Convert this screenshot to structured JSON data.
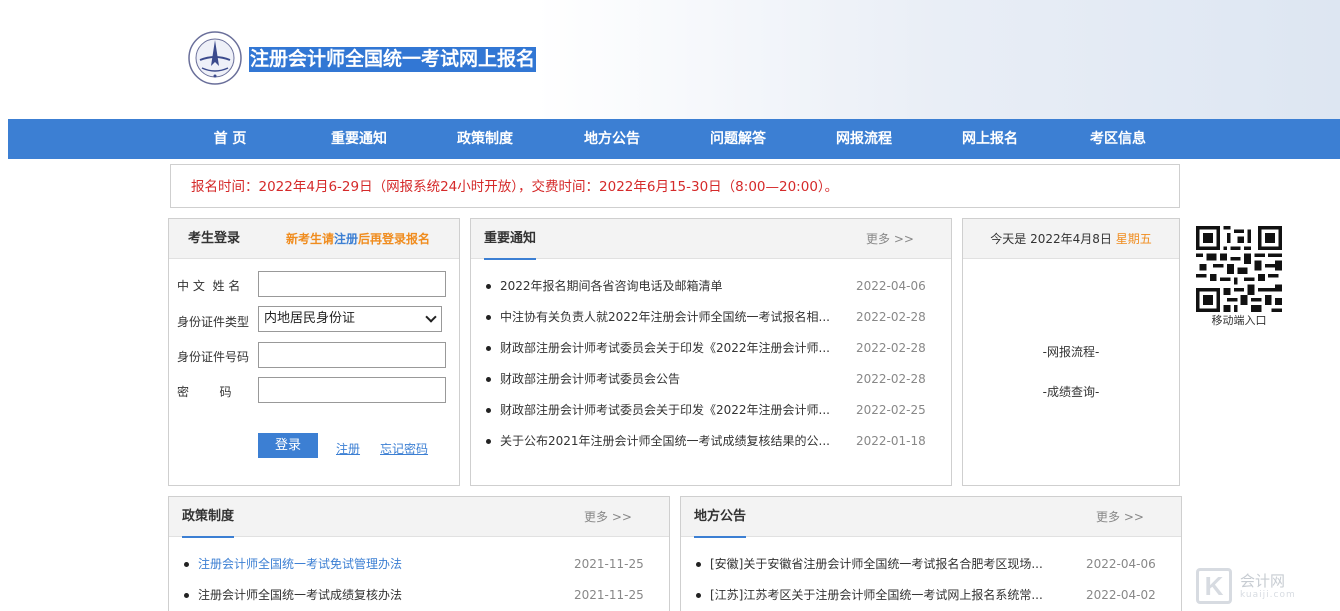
{
  "header": {
    "title": "注册会计师全国统一考试网上报名"
  },
  "nav": [
    "首 页",
    "重要通知",
    "政策制度",
    "地方公告",
    "问题解答",
    "网报流程",
    "网上报名",
    "考区信息"
  ],
  "notice": "报名时间：2022年4月6-29日（网报系统24小时开放），交费时间：2022年6月15-30日（8:00—20:00）。",
  "login": {
    "title": "考生登录",
    "new_prefix": "新考生请",
    "new_register": "注册",
    "new_suffix": "后再登录报名",
    "name_label": "中 文  姓 名",
    "idtype_label": "身份证件类型",
    "idtype_value": "内地居民身份证",
    "idno_label": "身份证件号码",
    "password_label": "密        码",
    "login_button": "登录",
    "register_link": "注册",
    "forgot_link": "忘记密码"
  },
  "important": {
    "title": "重要通知",
    "more": "更多 >>",
    "items": [
      {
        "text": "2022年报名期间各省咨询电话及邮箱清单",
        "date": "2022-04-06"
      },
      {
        "text": "中注协有关负责人就2022年注册会计师全国统一考试报名相...",
        "date": "2022-02-28"
      },
      {
        "text": "财政部注册会计师考试委员会关于印发《2022年注册会计师...",
        "date": "2022-02-28"
      },
      {
        "text": "财政部注册会计师考试委员会公告",
        "date": "2022-02-28"
      },
      {
        "text": "财政部注册会计师考试委员会关于印发《2022年注册会计师...",
        "date": "2022-02-25"
      },
      {
        "text": "关于公布2021年注册会计师全国统一考试成绩复核结果的公...",
        "date": "2022-01-18"
      }
    ]
  },
  "today": {
    "prefix": "今天是",
    "date": "2022年4月8日",
    "weekday": "星期五",
    "link1": "-网报流程-",
    "link2": "-成绩查询-"
  },
  "qr": {
    "label": "移动端入口"
  },
  "policy": {
    "title": "政策制度",
    "more": "更多 >>",
    "items": [
      {
        "text": "注册会计师全国统一考试免试管理办法",
        "date": "2021-11-25"
      },
      {
        "text": "注册会计师全国统一考试成绩复核办法",
        "date": "2021-11-25"
      }
    ]
  },
  "local": {
    "title": "地方公告",
    "more": "更多 >>",
    "items": [
      {
        "text": "[安徽]关于安徽省注册会计师全国统一考试报名合肥考区现场...",
        "date": "2022-04-06"
      },
      {
        "text": "[江苏]江苏考区关于注册会计师全国统一考试网上报名系统常...",
        "date": "2022-04-02"
      }
    ]
  },
  "watermark": {
    "mark": "K",
    "name": "会计网",
    "site": "kuaiji.com"
  },
  "colors": {
    "nav": "#3c7fd3",
    "accent_orange": "#f08c1e",
    "notice_red": "#d52a2a"
  }
}
